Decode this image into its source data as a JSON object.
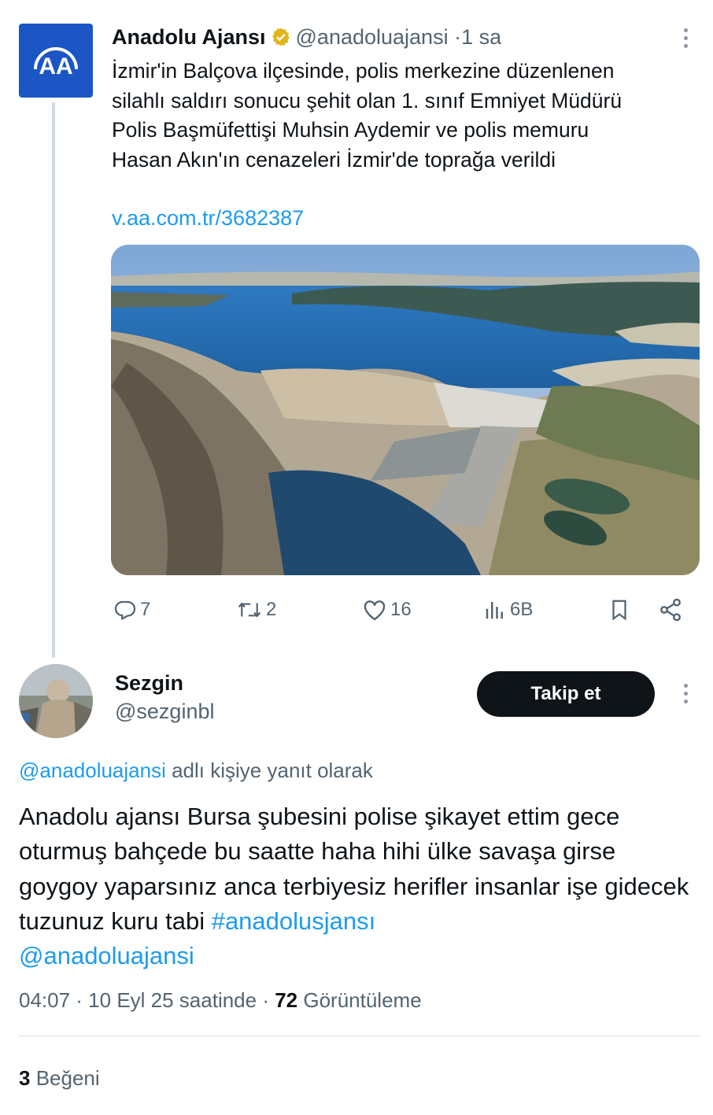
{
  "tweet1": {
    "author_name": "Anadolu Ajansı",
    "author_handle": "@anadoluajansi",
    "separator": "·",
    "time": "1 sa",
    "logo_text": "AA",
    "text_lines": [
      "İzmir'in Balçova ilçesinde, polis merkezine düzenlenen",
      "silahlı saldırı sonucu şehit olan 1. sınıf Emniyet Müdürü",
      "Polis Başmüfettişi Muhsin Aydemir ve polis memuru",
      "Hasan Akın'ın cenazeleri İzmir'de toprağa verildi"
    ],
    "link": "v.aa.com.tr/3682387",
    "actions": {
      "replies": "7",
      "retweets": "2",
      "likes": "16",
      "views": "6B"
    }
  },
  "tweet2": {
    "author_name": "Sezgin",
    "author_handle": "@sezginbl",
    "follow_label": "Takip et",
    "reply_mention": "@anadoluajansi",
    "reply_suffix": " adlı kişiye yanıt olarak",
    "text": "Anadolu ajansı Bursa şubesini polise şikayet ettim gece oturmuş bahçede bu saatte haha hihi ülke savaşa girse goygoy yaparsınız anca terbiyesiz herifler insanlar işe gidecek tuzunuz kuru tabi ",
    "hashtag": "#anadolusjansı",
    "mention": "@anadoluajansi",
    "meta_time": "04:07 · 10 Eyl 25 saatinde · ",
    "meta_views_count": "72",
    "meta_views_label": " Görüntüleme",
    "likes_count": "3",
    "likes_label": " Beğeni"
  },
  "colors": {
    "accent": "#1d9bf0",
    "muted": "#536471",
    "text": "#0f1419",
    "aa_blue": "#1b56c4",
    "verified_gold": "#e2b719"
  },
  "icons": [
    "reply-icon",
    "retweet-icon",
    "like-icon",
    "views-icon",
    "bookmark-icon",
    "share-icon",
    "verified-badge-icon",
    "more-icon"
  ]
}
